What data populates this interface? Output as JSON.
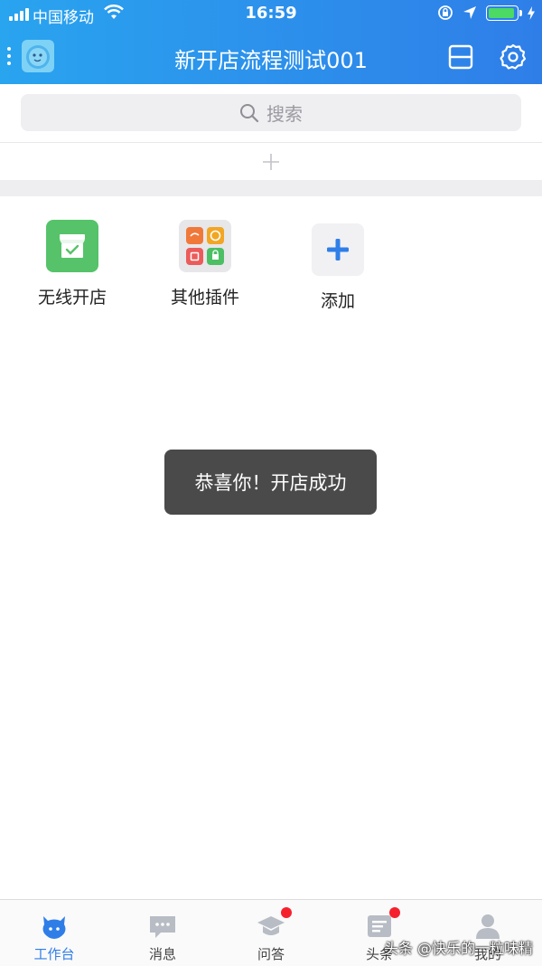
{
  "status_bar": {
    "carrier": "中国移动",
    "time": "16:59"
  },
  "header": {
    "title": "新开店流程测试001"
  },
  "search": {
    "placeholder": "搜索"
  },
  "apps": [
    {
      "label": "无线开店",
      "icon": "store-icon",
      "color": "#56c36a"
    },
    {
      "label": "其他插件",
      "icon": "plugins-icon",
      "color": "#e7e7ea"
    },
    {
      "label": "添加",
      "icon": "plus-icon",
      "color": "#f1f1f3"
    }
  ],
  "toast": {
    "message": "恭喜你！开店成功"
  },
  "tabs": [
    {
      "label": "工作台",
      "icon": "workbench-icon",
      "active": true
    },
    {
      "label": "消息",
      "icon": "message-icon"
    },
    {
      "label": "问答",
      "icon": "qa-icon",
      "badge": true
    },
    {
      "label": "头条",
      "icon": "news-icon",
      "badge": true
    },
    {
      "label": "我的",
      "icon": "profile-icon"
    }
  ],
  "watermark": "头条 @快乐的一粒味精",
  "colors": {
    "header_start": "#29a4ef",
    "header_end": "#2f7ee8",
    "accent": "#2f7ee8",
    "badge": "#f5222d"
  }
}
